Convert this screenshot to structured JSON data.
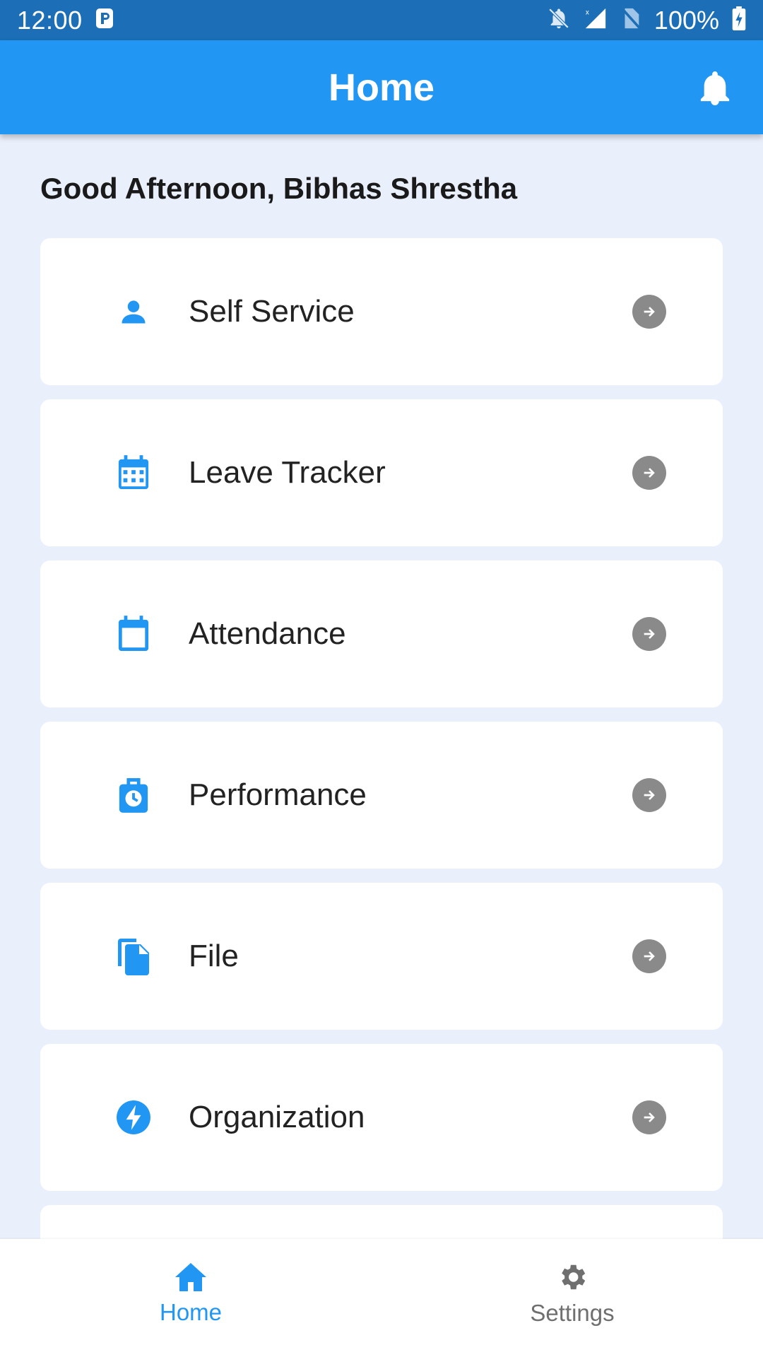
{
  "status_bar": {
    "time": "12:00",
    "notification_icon": "p-letter-icon",
    "battery_percent": "100%"
  },
  "app_bar": {
    "title": "Home",
    "action_icon": "bell-icon"
  },
  "greeting": "Good Afternoon, Bibhas Shrestha",
  "menu": {
    "items": [
      {
        "label": "Self Service",
        "icon": "person-icon"
      },
      {
        "label": "Leave Tracker",
        "icon": "calendar-grid-icon"
      },
      {
        "label": "Attendance",
        "icon": "calendar-icon"
      },
      {
        "label": "Performance",
        "icon": "clock-bag-icon"
      },
      {
        "label": "File",
        "icon": "files-icon"
      },
      {
        "label": "Organization",
        "icon": "bolt-icon"
      }
    ]
  },
  "bottom_nav": {
    "items": [
      {
        "label": "Home",
        "icon": "home-icon",
        "active": true
      },
      {
        "label": "Settings",
        "icon": "gear-icon",
        "active": false
      }
    ]
  },
  "colors": {
    "status_bar": "#1c6fb6",
    "app_bar": "#2196f3",
    "background": "#e9effb",
    "icon_accent": "#2196f3",
    "arrow_circle": "#8a8a8a",
    "nav_inactive": "#6f6f6f"
  }
}
